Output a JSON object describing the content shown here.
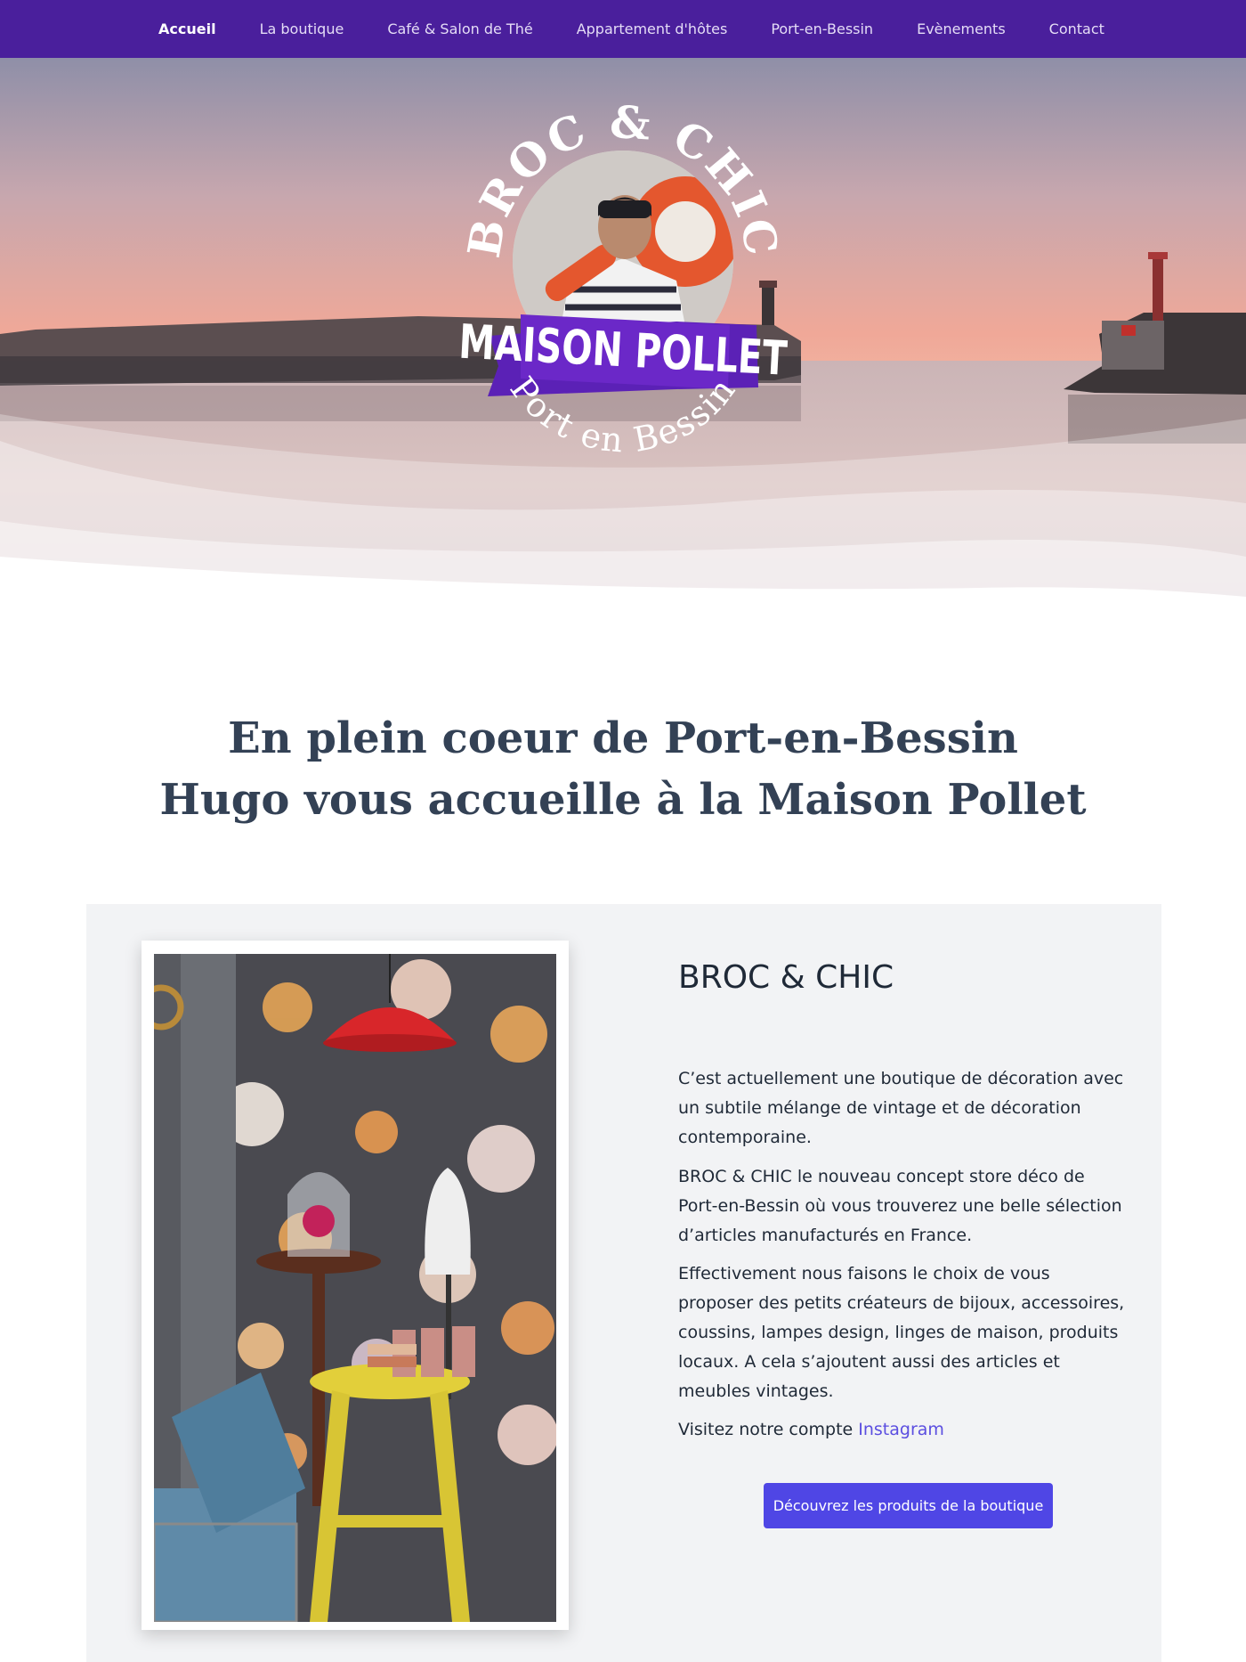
{
  "nav": {
    "items": [
      {
        "label": "Accueil",
        "active": true
      },
      {
        "label": "La boutique"
      },
      {
        "label": "Café & Salon de Thé"
      },
      {
        "label": "Appartement d'hôtes"
      },
      {
        "label": "Port-en-Bessin"
      },
      {
        "label": "Evènements"
      },
      {
        "label": "Contact"
      }
    ]
  },
  "logo": {
    "top_text": "BROC & CHIC",
    "banner_text": "MAISON POLLET",
    "bottom_text": "Port en Bessin"
  },
  "headline": {
    "line1": "En plein coeur de Port-en-Bessin",
    "line2": "Hugo vous accueille à la Maison Pollet"
  },
  "section": {
    "title": "BROC & CHIC",
    "p1": "C’est actuellement une boutique de décoration avec un subtile mélange de vintage et de décoration contemporaine.",
    "p2": "BROC & CHIC le nouveau concept store déco de Port-en-Bessin où vous trouverez une belle sélection d’articles manufacturés en France.",
    "p3": "Effectivement nous faisons le choix de vous proposer des petits créateurs de bijoux, accessoires, coussins, lampes design, linges de maison, produits locaux. A cela s’ajoutent aussi des articles et meubles vintages.",
    "p4_prefix": "Visitez notre compte ",
    "p4_link": "Instagram",
    "cta_label": "Découvrez les produits de la boutique"
  },
  "colors": {
    "nav_bg": "#4a1f9c",
    "accent": "#4f46e5",
    "heading": "#334155",
    "card_bg": "#f2f3f5"
  }
}
